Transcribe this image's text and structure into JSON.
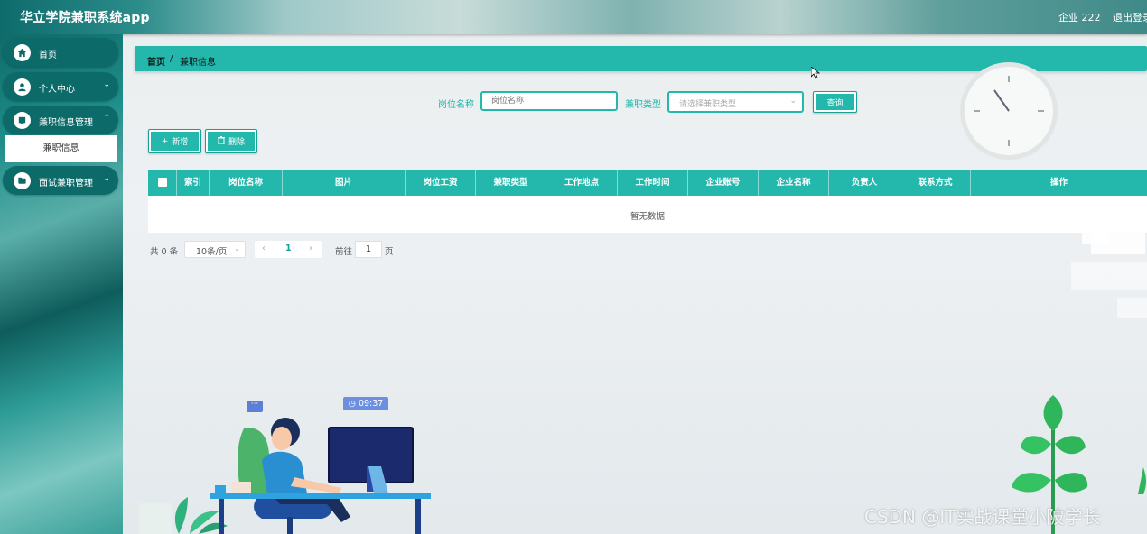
{
  "header": {
    "app_title": "华立学院兼职系统app",
    "user_label": "企业 222",
    "logout_label": "退出登录"
  },
  "sidebar": {
    "items": [
      {
        "label": "首页",
        "icon": "home-icon"
      },
      {
        "label": "个人中心",
        "icon": "user-icon"
      },
      {
        "label": "兼职信息管理",
        "icon": "document-icon"
      },
      {
        "label": "面试兼职管理",
        "icon": "folder-icon"
      }
    ],
    "submenu": {
      "label": "兼职信息"
    }
  },
  "breadcrumb": {
    "home": "首页",
    "separator": "/",
    "current": "兼职信息"
  },
  "search": {
    "position_label": "岗位名称",
    "position_placeholder": "岗位名称",
    "type_label": "兼职类型",
    "type_placeholder": "请选择兼职类型",
    "query_button": "查询"
  },
  "actions": {
    "add_label": "新增",
    "delete_label": "删除"
  },
  "table": {
    "columns": [
      "索引",
      "岗位名称",
      "图片",
      "岗位工资",
      "兼职类型",
      "工作地点",
      "工作时间",
      "企业账号",
      "企业名称",
      "负责人",
      "联系方式",
      "操作"
    ],
    "empty_text": "暂无数据"
  },
  "pagination": {
    "total_text": "共 0 条",
    "page_size": "10条/页",
    "current_page": "1",
    "goto_label": "前往",
    "goto_value": "1",
    "page_label": "页"
  },
  "illustration": {
    "time": "09:37",
    "chat": "···"
  },
  "watermark": "CSDN @IT实战课堂小陂学长",
  "colors": {
    "accent": "#24b8ac",
    "sidebar_item": "#0c6a68"
  }
}
